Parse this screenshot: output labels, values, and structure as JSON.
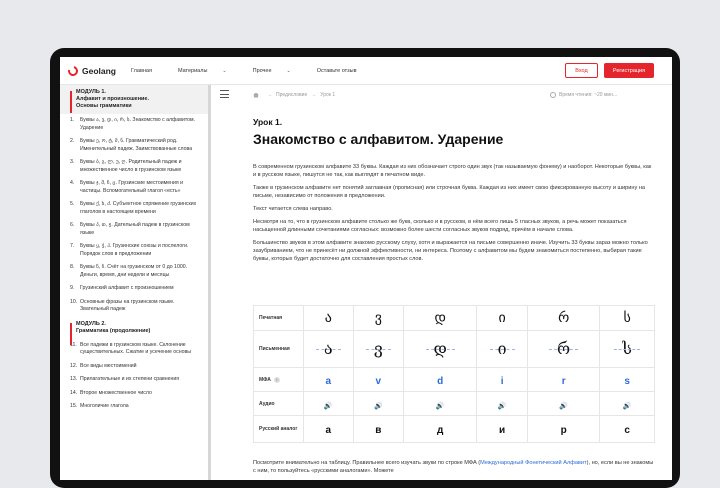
{
  "nav": {
    "logo": "Geolang",
    "links": [
      {
        "label": "Главная",
        "chevron": false,
        "accent": false
      },
      {
        "label": "Материалы",
        "chevron": true,
        "accent": false
      },
      {
        "label": "Прочее",
        "chevron": true,
        "accent": false
      },
      {
        "label": "Оставьте отзыв",
        "chevron": false,
        "accent": true
      }
    ],
    "login": "Вход",
    "register": "Регистрация"
  },
  "sidebar": {
    "module1": {
      "title": "МОДУЛЬ 1.",
      "subtitle": "Алфавит и произношение.",
      "subtitle2": "Основы грамматики"
    },
    "lessons1": [
      {
        "num": "1.",
        "text": "Буквы ა, ვ, დ, ი, რ, ს. Знакомство с алфавитом. Ударение"
      },
      {
        "num": "2.",
        "text": "Буквы ე, ო, ტ, მ, ნ. Грамматический род. Именительный падеж. Заимствованные слова"
      },
      {
        "num": "3.",
        "text": "Буквы ბ, გ, ლ, უ, ღ. Родительный падеж и множественное число в грузинском языке"
      },
      {
        "num": "4.",
        "text": "Буквы ჯ, შ, ჩ, ც. Грузинские местоимения и частицы. Вспомогательный глагол «есть»"
      },
      {
        "num": "5.",
        "text": "Буквы ქ, ხ, ძ. Субъектное спряжение грузинских глаголов в настоящем времени"
      },
      {
        "num": "6.",
        "text": "Буквы პ, თ, ჟ. Дательный падеж в грузинском языке"
      },
      {
        "num": "7.",
        "text": "Буквы ყ, ჭ, ჰ. Грузинские союзы и послелоги. Порядок слов в предложении"
      },
      {
        "num": "8.",
        "text": "Буквы წ, ჩ. Счёт на грузинском от 0 до 1000. Деньги, время, дни недели и месяцы"
      },
      {
        "num": "9.",
        "text": "Грузинский алфавит с произношением"
      },
      {
        "num": "10.",
        "text": "Основные фразы на грузинском языке. Звательный падеж"
      }
    ],
    "module2": {
      "title": "МОДУЛЬ 2.",
      "subtitle": "Грамматика (продолжение)"
    },
    "lessons2": [
      {
        "num": "11.",
        "text": "Все падежи в грузинском языке. Склонение существительных. Сжатие и усечение основы"
      },
      {
        "num": "12.",
        "text": "Все виды местоимений"
      },
      {
        "num": "13.",
        "text": "Прилагательные и их степени сравнения"
      },
      {
        "num": "14.",
        "text": "Второе множественное число"
      },
      {
        "num": "15.",
        "text": "Многоличие глагола"
      }
    ]
  },
  "breadcrumb": {
    "section": "Предисловие",
    "current": "Урок 1"
  },
  "readtime": "Время чтения: ~20 мин...",
  "lesson": {
    "number": "Урок 1.",
    "title": "Знакомство с алфавитом. Ударение"
  },
  "paragraphs": [
    "В современном грузинском алфавите 33 буквы. Каждая из них обозначает строго один звук (так называемую фонему) и наоборот. Некоторые буквы, как и в русском языке, пишутся не так, как выглядят в печатном виде.",
    "Также в грузинском алфавите нет понятий заглавная (прописная) или строчная буква. Каждая из них имеет свою фиксированную высоту и ширину на письме, независимо от положения в предложении.",
    "Текст читается слева направо.",
    "Несмотря на то, что в грузинском алфавите столько же букв, сколько и в русском, в нём всего лишь 5 гласных звуков, а речь может показаться насыщенной длинными сочетаниями согласных: возможно более шести согласных звуков подряд, причём в начале слова.",
    "Большинство звуков в этом алфавите знакомо русскому слуху, хотя и выражается на письме совершенно иначе. Изучить 33 буквы зараз можно только зазубриванием, что не принесёт ни должной эффективности, ни интереса. Поэтому с алфавитом мы будем знакомиться постепенно, выбирая такие буквы, которых будет достаточно для составления простых слов."
  ],
  "table": {
    "row_labels": {
      "printed": "Печатная",
      "written": "Письменная",
      "ipa": "МФА",
      "audio": "Аудио",
      "russian": "Русский аналог"
    },
    "info_icon": "i",
    "letters": [
      {
        "printed": "ა",
        "written": "ა",
        "ipa": "a",
        "russian": "а"
      },
      {
        "printed": "ვ",
        "written": "ვ",
        "ipa": "v",
        "russian": "в"
      },
      {
        "printed": "დ",
        "written": "დ",
        "ipa": "d",
        "russian": "д"
      },
      {
        "printed": "ი",
        "written": "ი",
        "ipa": "i",
        "russian": "и"
      },
      {
        "printed": "რ",
        "written": "რ",
        "ipa": "r",
        "russian": "р"
      },
      {
        "printed": "ს",
        "written": "ს",
        "ipa": "s",
        "russian": "с"
      }
    ]
  },
  "after": {
    "before_link": "Посмотрите внимательно на таблицу. Правильнее всего изучать звуки по строке МФА (",
    "link": "Международный Фонетический Алфавит",
    "after_link": "), но, если вы не знакомы с ним, то пользуйтесь «русскими аналогами». Можете"
  }
}
